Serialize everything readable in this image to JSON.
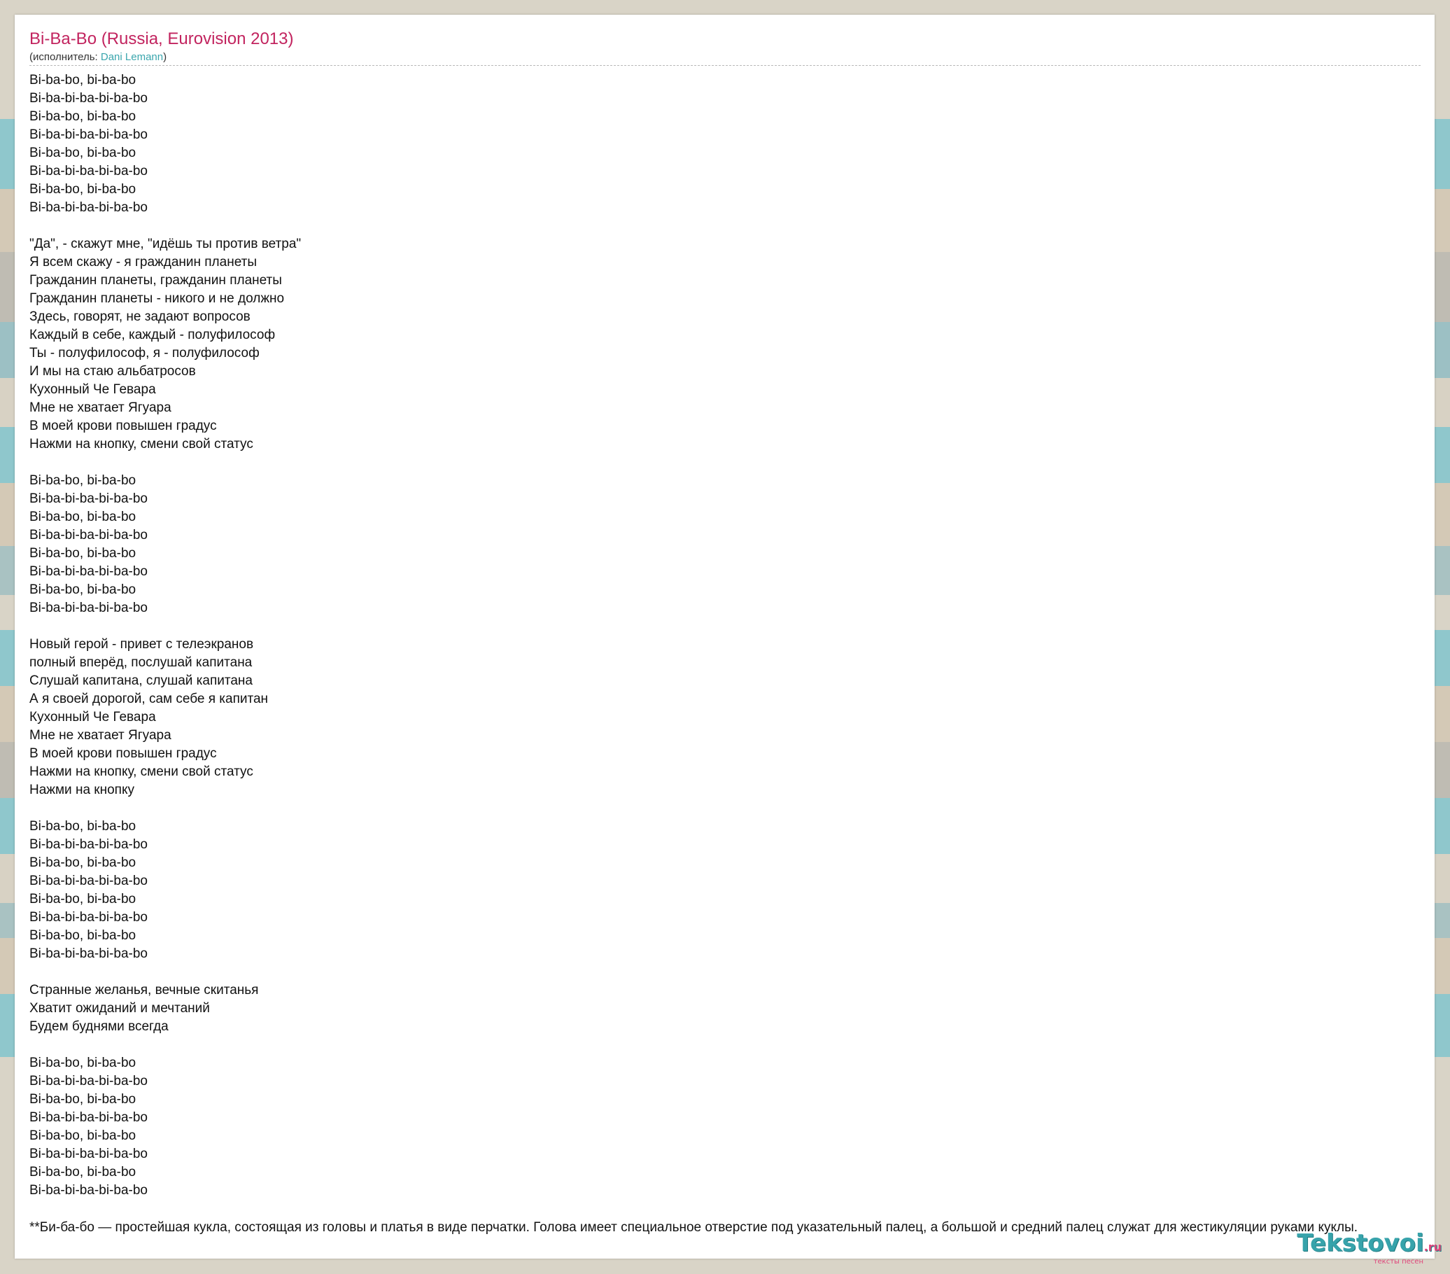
{
  "song": {
    "title": "Bi-Ba-Bo (Russia, Eurovision 2013)",
    "byline_prefix": "(исполнитель: ",
    "artist": "Dani Lemann",
    "byline_suffix": ")"
  },
  "lyrics": [
    "Bi-ba-bo, bi-ba-bo",
    "Bi-ba-bi-ba-bi-ba-bo",
    "Bi-ba-bo, bi-ba-bo",
    "Bi-ba-bi-ba-bi-ba-bo",
    "Bi-ba-bo, bi-ba-bo",
    "Bi-ba-bi-ba-bi-ba-bo",
    "Bi-ba-bo, bi-ba-bo",
    "Bi-ba-bi-ba-bi-ba-bo",
    "",
    "\"Да\", - скажут мне, \"идёшь ты против ветра\"",
    "Я всем скажу - я гражданин планеты",
    "Гражданин планеты, гражданин планеты",
    "Гражданин планеты - никого и не должно",
    "Здесь, говорят, не задают вопросов",
    "Каждый в себе, каждый - полуфилософ",
    "Ты - полуфилософ, я - полуфилософ",
    "И мы на стаю альбатросов",
    "Кухонный Че Гевара",
    "Мне не хватает Ягуара",
    "В моей крови повышен градус",
    "Нажми на кнопку, смени свой статус",
    "",
    "Bi-ba-bo, bi-ba-bo",
    "Bi-ba-bi-ba-bi-ba-bo",
    "Bi-ba-bo, bi-ba-bo",
    "Bi-ba-bi-ba-bi-ba-bo",
    "Bi-ba-bo, bi-ba-bo",
    "Bi-ba-bi-ba-bi-ba-bo",
    "Bi-ba-bo, bi-ba-bo",
    "Bi-ba-bi-ba-bi-ba-bo",
    "",
    "Новый герой - привет с телеэкранов",
    "полный вперёд, послушай капитана",
    "Слушай капитана, слушай капитана",
    "А я своей дорогой, сам себе я капитан",
    "Кухонный Че Гевара",
    "Мне не хватает Ягуара",
    "В моей крови повышен градус",
    "Нажми на кнопку, смени свой статус",
    "Нажми на кнопку",
    "",
    "Bi-ba-bo, bi-ba-bo",
    "Bi-ba-bi-ba-bi-ba-bo",
    "Bi-ba-bo, bi-ba-bo",
    "Bi-ba-bi-ba-bi-ba-bo",
    "Bi-ba-bo, bi-ba-bo",
    "Bi-ba-bi-ba-bi-ba-bo",
    "Bi-ba-bo, bi-ba-bo",
    "Bi-ba-bi-ba-bi-ba-bo",
    "",
    "Странные желанья, вечные скитанья",
    "Хватит ожиданий и мечтаний",
    "Будем буднями всегда",
    "",
    "Bi-ba-bo, bi-ba-bo",
    "Bi-ba-bi-ba-bi-ba-bo",
    "Bi-ba-bo, bi-ba-bo",
    "Bi-ba-bi-ba-bi-ba-bo",
    "Bi-ba-bo, bi-ba-bo",
    "Bi-ba-bi-ba-bi-ba-bo",
    "Bi-ba-bo, bi-ba-bo",
    "Bi-ba-bi-ba-bi-ba-bo"
  ],
  "footnote": "**Би-ба-бо — простейшая кукла, состоящая из головы и платья в виде перчатки. Голова имеет специальное отверстие под указательный палец, а большой и средний палец служат для жестикуляции руками куклы.",
  "logo": {
    "name": "Tekstovoi",
    "tld": ".ru",
    "tagline": "тексты песен"
  }
}
